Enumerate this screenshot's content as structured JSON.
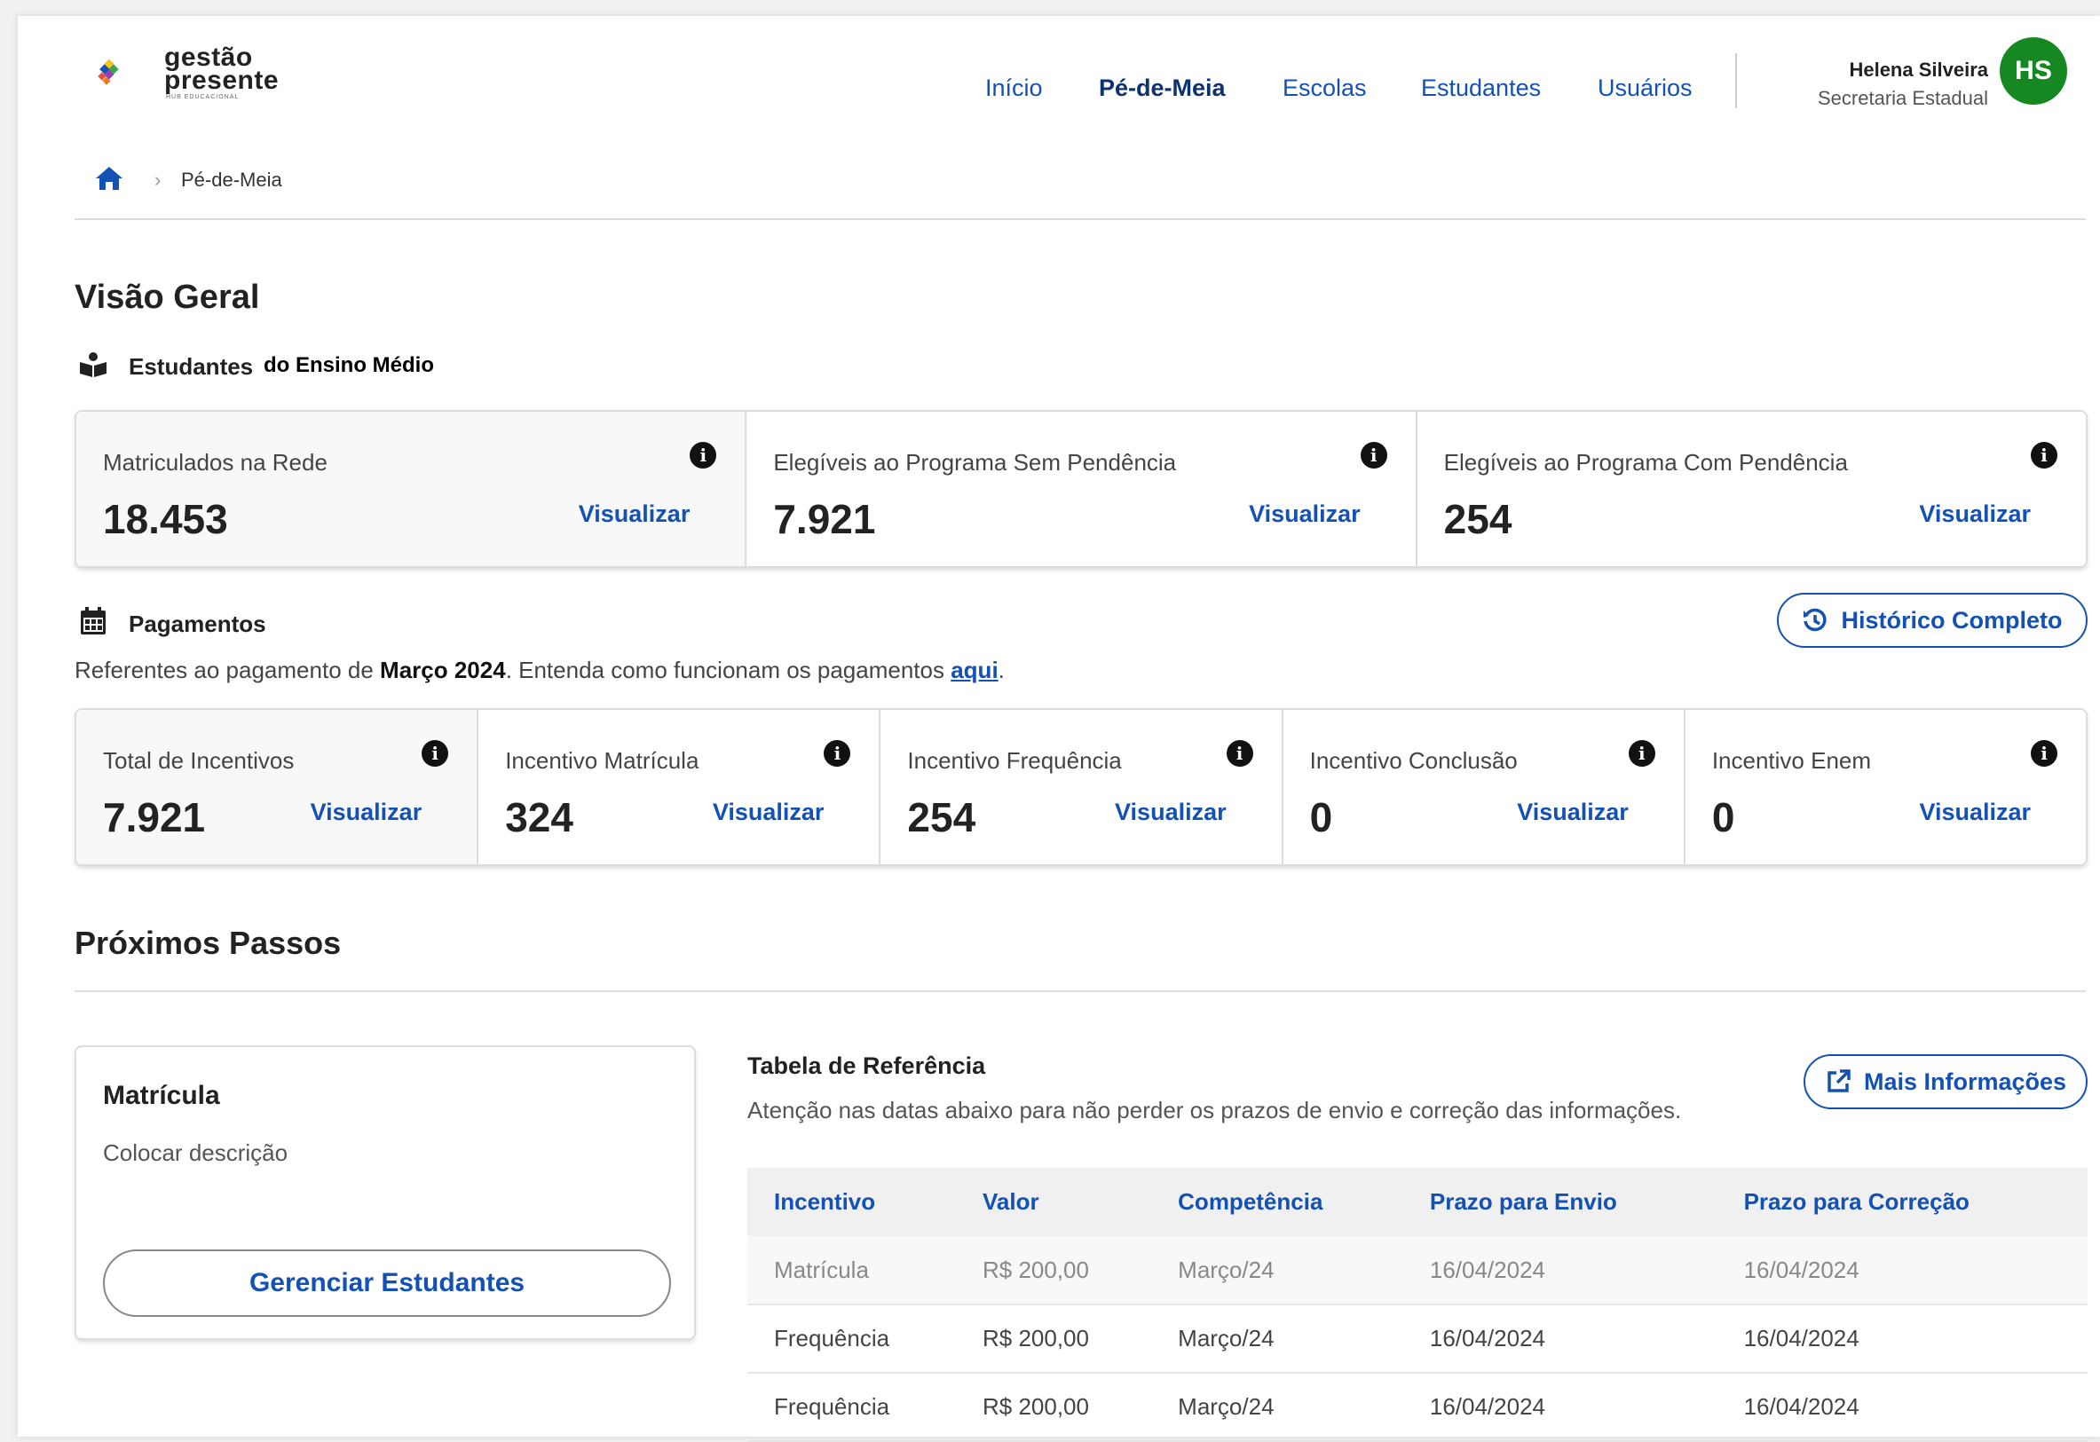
{
  "header": {
    "logo_line1": "gestão",
    "logo_line2": "presente",
    "logo_sub": "HUB EDUCACIONAL",
    "nav": [
      {
        "label": "Início",
        "active": false
      },
      {
        "label": "Pé-de-Meia",
        "active": true
      },
      {
        "label": "Escolas",
        "active": false
      },
      {
        "label": "Estudantes",
        "active": false
      },
      {
        "label": "Usuários",
        "active": false
      }
    ],
    "user_name": "Helena Silveira",
    "user_role": "Secretaria Estadual",
    "avatar_initials": "HS"
  },
  "breadcrumb": {
    "icon": "home-icon",
    "current": "Pé-de-Meia"
  },
  "overview": {
    "title": "Visão Geral",
    "students_section": {
      "icon": "book-reader-icon",
      "title": "Estudantes",
      "extra": "do Ensino Médio"
    },
    "student_cards": [
      {
        "label": "Matriculados na Rede",
        "value": "18.453",
        "link": "Visualizar"
      },
      {
        "label": "Elegíveis ao Programa Sem Pendência",
        "value": "7.921",
        "link": "Visualizar"
      },
      {
        "label": "Elegíveis ao Programa Com Pendência",
        "value": "254",
        "link": "Visualizar"
      }
    ],
    "payments_section": {
      "icon": "calendar-icon",
      "title": "Pagamentos",
      "desc_pre": "Referentes ao pagamento de ",
      "desc_bold": "Março 2024",
      "desc_mid": ". Entenda como funcionam os pagamentos ",
      "desc_link": "aqui",
      "desc_end": ".",
      "history_button": "Histórico Completo",
      "history_icon": "history-icon"
    },
    "payment_cards": [
      {
        "label": "Total de Incentivos",
        "value": "7.921",
        "link": "Visualizar"
      },
      {
        "label": "Incentivo Matrícula",
        "value": "324",
        "link": "Visualizar"
      },
      {
        "label": "Incentivo Frequência",
        "value": "254",
        "link": "Visualizar"
      },
      {
        "label": "Incentivo Conclusão",
        "value": "0",
        "link": "Visualizar"
      },
      {
        "label": "Incentivo Enem",
        "value": "0",
        "link": "Visualizar"
      }
    ]
  },
  "next_steps": {
    "title": "Próximos Passos",
    "card": {
      "title": "Matrícula",
      "desc": "Colocar descrição",
      "button": "Gerenciar Estudantes"
    },
    "table": {
      "title": "Tabela de Referência",
      "desc": "Atenção nas datas abaixo para não perder os prazos de envio e correção das informações.",
      "more_button": "Mais Informações",
      "more_icon": "external-link-icon",
      "columns": [
        "Incentivo",
        "Valor",
        "Competência",
        "Prazo para Envio",
        "Prazo para Correção"
      ],
      "rows": [
        [
          "Matrícula",
          "R$ 200,00",
          "Março/24",
          "16/04/2024",
          "16/04/2024"
        ],
        [
          "Frequência",
          "R$ 200,00",
          "Março/24",
          "16/04/2024",
          "16/04/2024"
        ],
        [
          "Frequência",
          "R$ 200,00",
          "Março/24",
          "16/04/2024",
          "16/04/2024"
        ]
      ]
    }
  },
  "colors": {
    "primary": "#1351b4",
    "primary_dark": "#0c326f",
    "avatar_bg": "#168821"
  }
}
